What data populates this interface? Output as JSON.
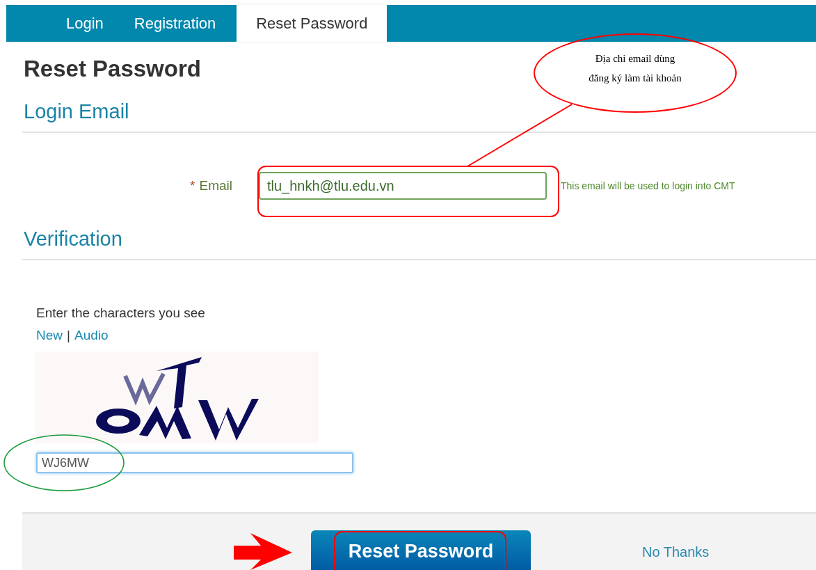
{
  "tabs": [
    {
      "label": "Login",
      "selected": false
    },
    {
      "label": "Registration",
      "selected": false
    },
    {
      "label": "Reset Password",
      "selected": true
    }
  ],
  "page_title": "Reset Password",
  "login_email": {
    "heading": "Login Email",
    "required_mark": "*",
    "label": "Email",
    "value": "tlu_hnkh@tlu.edu.vn",
    "help": "This email will be used to login into CMT"
  },
  "verification": {
    "heading": "Verification",
    "prompt": "Enter the characters you see",
    "links": [
      "New",
      "Audio"
    ],
    "separator": "|",
    "captcha": {
      "kind": "picture"
    },
    "value": "WJ6MW"
  },
  "footer": {
    "submit": "Reset Password",
    "cancel": "No Thanks"
  },
  "annotations": {
    "callout": [
      "Địa chỉ email dùng",
      "đăng ký làm tài khoản"
    ]
  }
}
